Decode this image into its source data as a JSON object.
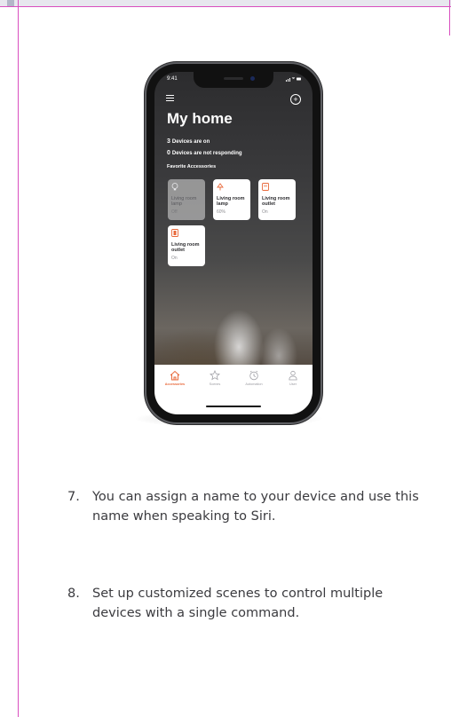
{
  "phone": {
    "status_time": "9:41",
    "title": "My home",
    "devices_on_count": "3",
    "devices_on_label": "Devices are on",
    "not_responding_count": "0",
    "not_responding_label": "Devices are not responding",
    "section_label": "Favorite Accessories",
    "tiles": [
      {
        "name": "Living room lamp",
        "state": "Off",
        "icon": "lightbulb-icon",
        "off": true
      },
      {
        "name": "Living room lamp",
        "state": "60%",
        "icon": "lightbulb-icon",
        "off": false
      },
      {
        "name": "Living room outlet",
        "state": "On",
        "icon": "outlet-icon",
        "off": false
      },
      {
        "name": "Living room outlet",
        "state": "On",
        "icon": "outlet-icon",
        "off": false
      }
    ],
    "tabs": [
      {
        "label": "Accessories",
        "icon": "house-icon",
        "active": true
      },
      {
        "label": "Scenes",
        "icon": "star-icon",
        "active": false
      },
      {
        "label": "Automation",
        "icon": "clock-icon",
        "active": false
      },
      {
        "label": "User",
        "icon": "user-icon",
        "active": false
      }
    ],
    "accent_color": "#e8683a"
  },
  "steps": [
    {
      "number": "7.",
      "text": "You can assign a name to your device and use this name when speaking to Siri."
    },
    {
      "number": "8.",
      "text": "Set up customized scenes to control multiple devices with a single command."
    }
  ]
}
